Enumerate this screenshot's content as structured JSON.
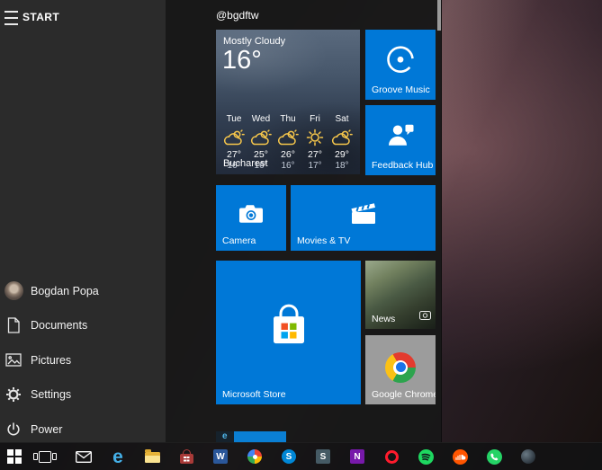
{
  "menu": {
    "header": "START",
    "group_label": "@bgdftw"
  },
  "weather": {
    "condition": "Mostly Cloudy",
    "temperature": "16°",
    "city": "Bucharest",
    "forecast": [
      {
        "day": "Tue",
        "high": "27°",
        "low": "16°",
        "icon": "partly-cloudy"
      },
      {
        "day": "Wed",
        "high": "25°",
        "low": "16°",
        "icon": "partly-cloudy"
      },
      {
        "day": "Thu",
        "high": "26°",
        "low": "16°",
        "icon": "partly-cloudy"
      },
      {
        "day": "Fri",
        "high": "27°",
        "low": "17°",
        "icon": "sunny"
      },
      {
        "day": "Sat",
        "high": "29°",
        "low": "18°",
        "icon": "partly-cloudy"
      }
    ]
  },
  "tiles": {
    "groove": {
      "label": "Groove Music",
      "color": "#0078d7"
    },
    "feedback": {
      "label": "Feedback Hub",
      "color": "#0078d7"
    },
    "camera": {
      "label": "Camera",
      "color": "#0078d7"
    },
    "movies": {
      "label": "Movies & TV",
      "color": "#0078d7"
    },
    "store": {
      "label": "Microsoft Store",
      "color": "#0078d7"
    },
    "news": {
      "label": "News"
    },
    "chrome": {
      "label": "Google Chrome"
    },
    "partial": {
      "glyph": "e"
    }
  },
  "sidebar": {
    "items": [
      {
        "label": "Bogdan Popa",
        "icon": "user-avatar"
      },
      {
        "label": "Documents",
        "icon": "document"
      },
      {
        "label": "Pictures",
        "icon": "pictures"
      },
      {
        "label": "Settings",
        "icon": "gear"
      },
      {
        "label": "Power",
        "icon": "power"
      }
    ]
  },
  "taskbar": {
    "glyphs": {
      "edge": "e",
      "word": "W",
      "skype": "S",
      "s_app": "S",
      "onenote": "N"
    }
  },
  "colors": {
    "tile_blue": "#0078d7",
    "menu_rail": "#2b2b2b",
    "menu_bg": "#181818",
    "taskbar": "#121214"
  }
}
